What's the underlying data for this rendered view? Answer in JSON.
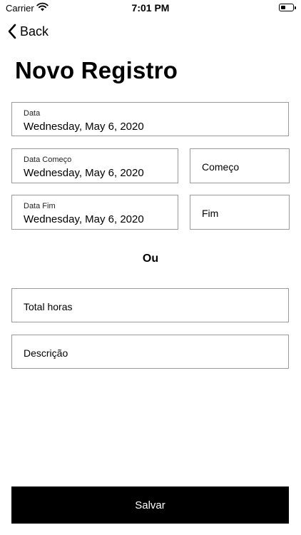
{
  "status_bar": {
    "carrier": "Carrier",
    "time": "7:01 PM",
    "battery_level": 0.4
  },
  "nav": {
    "back_label": "Back"
  },
  "page": {
    "title": "Novo Registro",
    "separator": "Ou"
  },
  "fields": {
    "data": {
      "label": "Data",
      "value": "Wednesday, May 6, 2020"
    },
    "data_comeco": {
      "label": "Data Começo",
      "value": "Wednesday, May 6, 2020"
    },
    "comeco": {
      "placeholder": "Começo"
    },
    "data_fim": {
      "label": "Data Fim",
      "value": "Wednesday, May 6, 2020"
    },
    "fim": {
      "placeholder": "Fim"
    },
    "total_horas": {
      "placeholder": "Total horas"
    },
    "descricao": {
      "placeholder": "Descrição"
    }
  },
  "actions": {
    "save_label": "Salvar"
  },
  "colors": {
    "primary_button": "#000000",
    "border": "#9a9a9a",
    "background": "#ffffff"
  },
  "icons": {
    "back": "chevron-left-icon",
    "wifi": "wifi-icon",
    "battery": "battery-icon"
  }
}
